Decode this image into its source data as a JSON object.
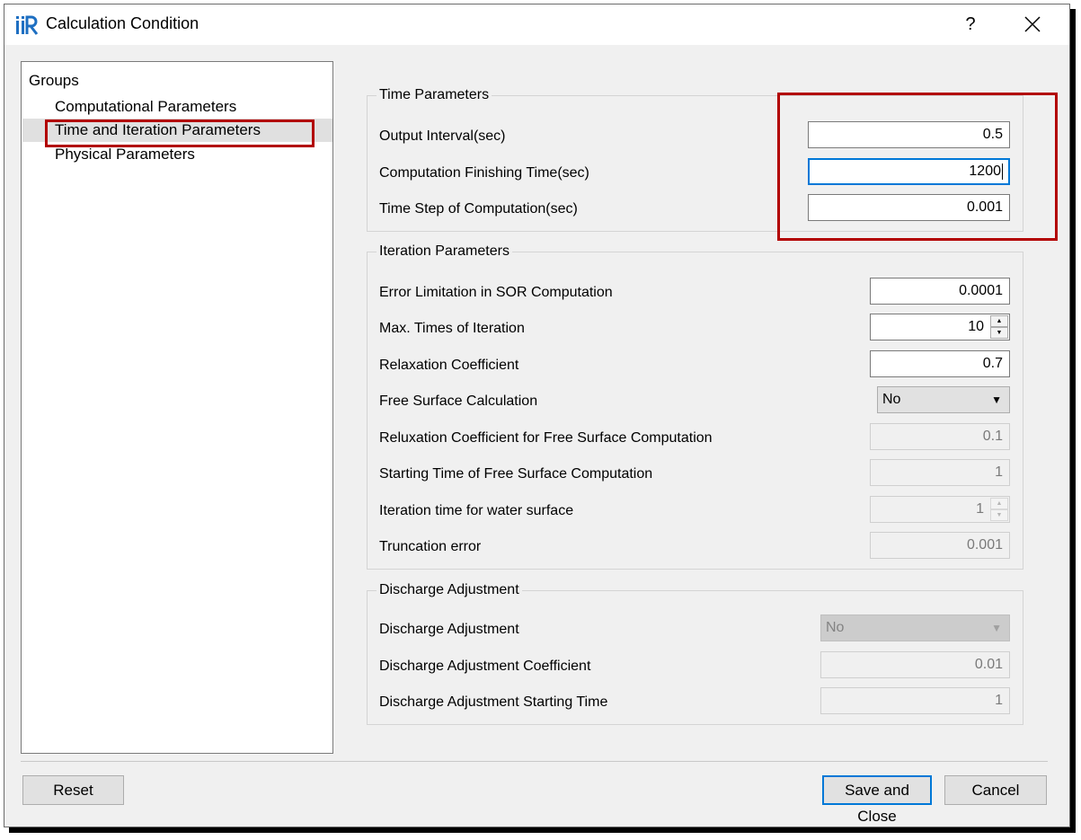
{
  "window": {
    "title": "Calculation Condition",
    "help": "?",
    "close_icon": "close-icon"
  },
  "tree": {
    "header": "Groups",
    "items": [
      {
        "label": "Computational Parameters",
        "selected": false
      },
      {
        "label": "Time and Iteration Parameters",
        "selected": true
      },
      {
        "label": "Physical Parameters",
        "selected": false
      }
    ]
  },
  "time_parameters": {
    "title": "Time Parameters",
    "rows": [
      {
        "label": "Output Interval(sec)",
        "value": "0.5"
      },
      {
        "label": "Computation Finishing Time(sec)",
        "value": "1200",
        "focused": true
      },
      {
        "label": "Time Step of Computation(sec)",
        "value": "0.001"
      }
    ]
  },
  "iteration_parameters": {
    "title": "Iteration Parameters",
    "rows": [
      {
        "label": "Error Limitation in SOR Computation",
        "value": "0.0001",
        "kind": "input"
      },
      {
        "label": "Max. Times of Iteration",
        "value": "10",
        "kind": "spin"
      },
      {
        "label": "Relaxation Coefficient",
        "value": "0.7",
        "kind": "input"
      },
      {
        "label": "Free Surface Calculation",
        "value": "No",
        "kind": "select"
      },
      {
        "label": "Reluxation Coefficient for Free Surface Computation",
        "value": "0.1",
        "kind": "input",
        "disabled": true
      },
      {
        "label": "Starting Time of Free Surface Computation",
        "value": "1",
        "kind": "input",
        "disabled": true
      },
      {
        "label": "Iteration time for water surface",
        "value": "1",
        "kind": "spin",
        "disabled": true
      },
      {
        "label": "Truncation error",
        "value": "0.001",
        "kind": "input",
        "disabled": true
      }
    ]
  },
  "discharge_adjustment": {
    "title": "Discharge Adjustment",
    "rows": [
      {
        "label": "Discharge Adjustment",
        "value": "No",
        "kind": "select",
        "disabled": true
      },
      {
        "label": "Discharge Adjustment Coefficient",
        "value": "0.01",
        "kind": "input",
        "disabled": true
      },
      {
        "label": "Discharge Adjustment Starting Time",
        "value": "1",
        "kind": "input",
        "disabled": true
      }
    ]
  },
  "buttons": {
    "reset": "Reset",
    "save_and_close": "Save and Close",
    "cancel": "Cancel"
  },
  "colors": {
    "highlight": "#b20000",
    "focus": "#0078d7",
    "dialog_bg": "#f0f0f0"
  }
}
